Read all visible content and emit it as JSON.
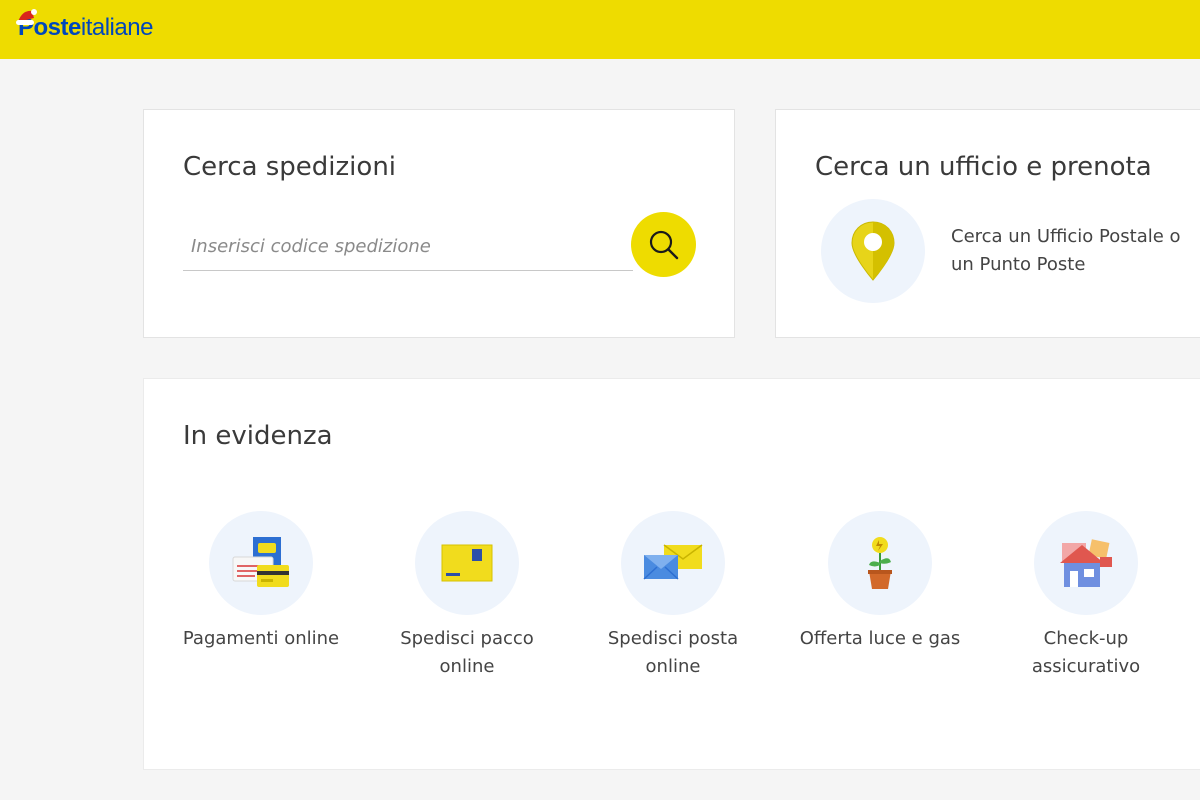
{
  "header": {
    "logo_bold": "Poste",
    "logo_rest": "italiane",
    "brand_color": "#eedc00",
    "logo_color": "#0047bb"
  },
  "search_card": {
    "title": "Cerca spedizioni",
    "placeholder": "Inserisci codice spedizione",
    "button_icon": "search-icon"
  },
  "office_card": {
    "title": "Cerca un ufficio e prenota",
    "icon": "location-pin-icon",
    "description": "Cerca un Ufficio Postale o un Punto Poste"
  },
  "featured": {
    "title": "In evidenza",
    "items": [
      {
        "label": "Pagamenti online",
        "icon": "payments-icon"
      },
      {
        "label": "Spedisci pacco online",
        "icon": "parcel-icon"
      },
      {
        "label": "Spedisci posta online",
        "icon": "mail-envelope-icon"
      },
      {
        "label": "Offerta luce e gas",
        "icon": "plant-energy-icon"
      },
      {
        "label": "Check-up assicurativo",
        "icon": "house-insurance-icon"
      }
    ]
  }
}
